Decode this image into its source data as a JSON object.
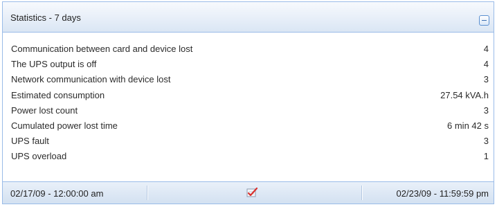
{
  "panel": {
    "title": "Statistics - 7 days",
    "collapse_icon": "minus-icon"
  },
  "stats": [
    {
      "label": "Communication between card and device lost",
      "value": "4"
    },
    {
      "label": "The UPS output is off",
      "value": "4"
    },
    {
      "label": "Network communication with device lost",
      "value": "3"
    },
    {
      "label": "Estimated consumption",
      "value": "27.54 kVA.h"
    },
    {
      "label": "Power lost count",
      "value": "3"
    },
    {
      "label": "Cumulated power lost time",
      "value": "6 min 42 s"
    },
    {
      "label": "UPS fault",
      "value": "3"
    },
    {
      "label": "UPS overload",
      "value": "1"
    }
  ],
  "footer": {
    "start_date": "02/17/09 - 12:00:00 am",
    "end_date": "02/23/09 - 11:59:59 pm",
    "center_icon": "chart-check-icon"
  },
  "colors": {
    "border": "#99bbe8",
    "header_bg": "#dae6f4",
    "icon_red": "#d9302c"
  }
}
